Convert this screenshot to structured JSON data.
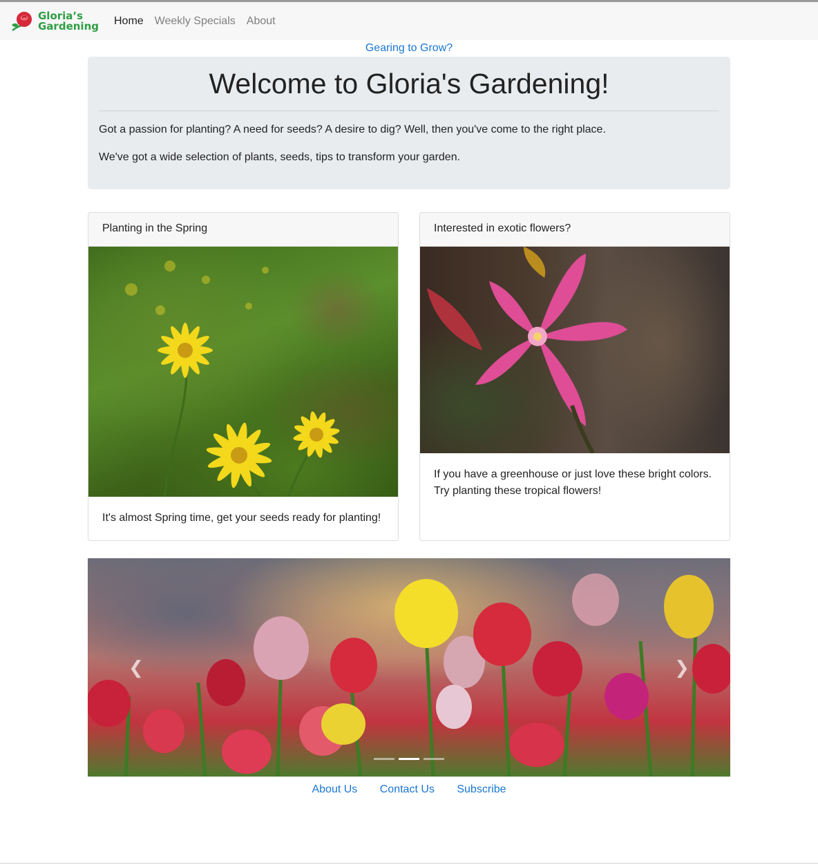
{
  "navbar": {
    "brand_line1": "Gloria’s",
    "brand_line2": "Gardening",
    "links": [
      {
        "label": "Home",
        "active": true
      },
      {
        "label": "Weekly Specials",
        "active": false
      },
      {
        "label": "About",
        "active": false
      }
    ]
  },
  "top_link": "Gearing to Grow?",
  "hero": {
    "title": "Welcome to Gloria's Gardening!",
    "paragraph1": "Got a passion for planting? A need for seeds? A desire to dig? Well, then you've come to the right place.",
    "paragraph2": "We've got a wide selection of plants, seeds, tips to transform your garden."
  },
  "cards": [
    {
      "header": "Planting in the Spring",
      "text": "It's almost Spring time, get your seeds ready for planting!"
    },
    {
      "header": "Interested in exotic flowers?",
      "text_line1": "If you have a greenhouse or just love these bright colors.",
      "text_line2": "Try planting these tropical flowers!"
    }
  ],
  "carousel": {
    "prev_icon": "chevron-left",
    "next_icon": "chevron-right",
    "active_slide": 2,
    "slide_count": 3
  },
  "footer": {
    "links": [
      "About Us",
      "Contact Us",
      "Subscribe"
    ]
  },
  "colors": {
    "brand_green": "#2f9e44",
    "brand_rose": "#d6283a",
    "link_blue": "#1976d2",
    "jumbotron_bg": "#e9ecef"
  }
}
